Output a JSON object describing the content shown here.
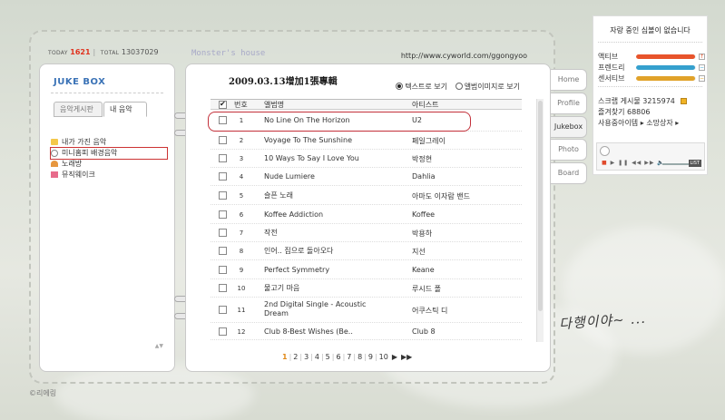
{
  "counter": {
    "today_label": "TODAY",
    "today": "1621",
    "total_label": "TOTAL",
    "total": "13037029"
  },
  "site": {
    "title": "Monster's house",
    "url": "http://www.cyworld.com/ggongyoo"
  },
  "left": {
    "title": "JUKE BOX",
    "tabs": [
      {
        "label": "음악게시판"
      },
      {
        "label": "내 음악"
      }
    ],
    "tree": [
      {
        "label": "내가 가진 음악",
        "icon": "folder-icon"
      },
      {
        "label": "미니홈피 배경음악",
        "icon": "disc-icon"
      },
      {
        "label": "노래방",
        "icon": "note-icon"
      },
      {
        "label": "뮤직웨이크",
        "icon": "gift-icon"
      }
    ]
  },
  "main": {
    "album_title": "2009.03.13增加1張專輯",
    "view_text": "텍스트로 보기",
    "view_image": "앨범이미지로 보기",
    "columns": {
      "no": "번호",
      "album": "앨범명",
      "artist": "아티스트"
    },
    "rows": [
      {
        "no": "1",
        "title": "No Line On The Horizon",
        "artist": "U2"
      },
      {
        "no": "2",
        "title": "Voyage To The Sunshine",
        "artist": "페일그레이"
      },
      {
        "no": "3",
        "title": "10 Ways To Say I Love You",
        "artist": "박정현"
      },
      {
        "no": "4",
        "title": "Nude Lumiere",
        "artist": "Dahlia"
      },
      {
        "no": "5",
        "title": "슬픈 노래",
        "artist": "아마도 이자람 밴드"
      },
      {
        "no": "6",
        "title": "Koffee Addiction",
        "artist": "Koffee"
      },
      {
        "no": "7",
        "title": "작전",
        "artist": "박용하"
      },
      {
        "no": "8",
        "title": "인어.. 집으로 돌아오다",
        "artist": "지선"
      },
      {
        "no": "9",
        "title": "Perfect Symmetry",
        "artist": "Keane"
      },
      {
        "no": "10",
        "title": "물고기 마음",
        "artist": "루시드 폴"
      },
      {
        "no": "11",
        "title": "2nd Digital Single - Acoustic Dream",
        "artist": "어쿠스틱 디"
      },
      {
        "no": "12",
        "title": "Club 8-Best Wishes (Be..",
        "artist": "Club 8"
      }
    ],
    "pager": {
      "pages": [
        "1",
        "2",
        "3",
        "4",
        "5",
        "6",
        "7",
        "8",
        "9",
        "10"
      ],
      "current": "1",
      "next": "▶",
      "last": "▶▶"
    }
  },
  "nav": [
    {
      "label": "Home"
    },
    {
      "label": "Profile"
    },
    {
      "label": "Jukebox"
    },
    {
      "label": "Photo"
    },
    {
      "label": "Board"
    }
  ],
  "widget": {
    "message": "자랑 중인 심볼이 없습니다",
    "stats": [
      {
        "label": "액티브",
        "value": 0.98,
        "color": "#e8542b",
        "mark": "↑"
      },
      {
        "label": "프렌드리",
        "value": 0.98,
        "color": "#35a0ce",
        "mark": "−"
      },
      {
        "label": "센서티브",
        "value": 0.98,
        "color": "#e1a229",
        "mark": "−"
      }
    ],
    "info": [
      {
        "text": "스크랩 게시물 3215974"
      },
      {
        "text": "즐겨찾기 68806"
      },
      {
        "text": "사용중아이템 ▸ 소망상자 ▸"
      }
    ],
    "player": {
      "list": "LIST"
    }
  },
  "signature": "다행이야~ ...",
  "copyright": "©리에링"
}
